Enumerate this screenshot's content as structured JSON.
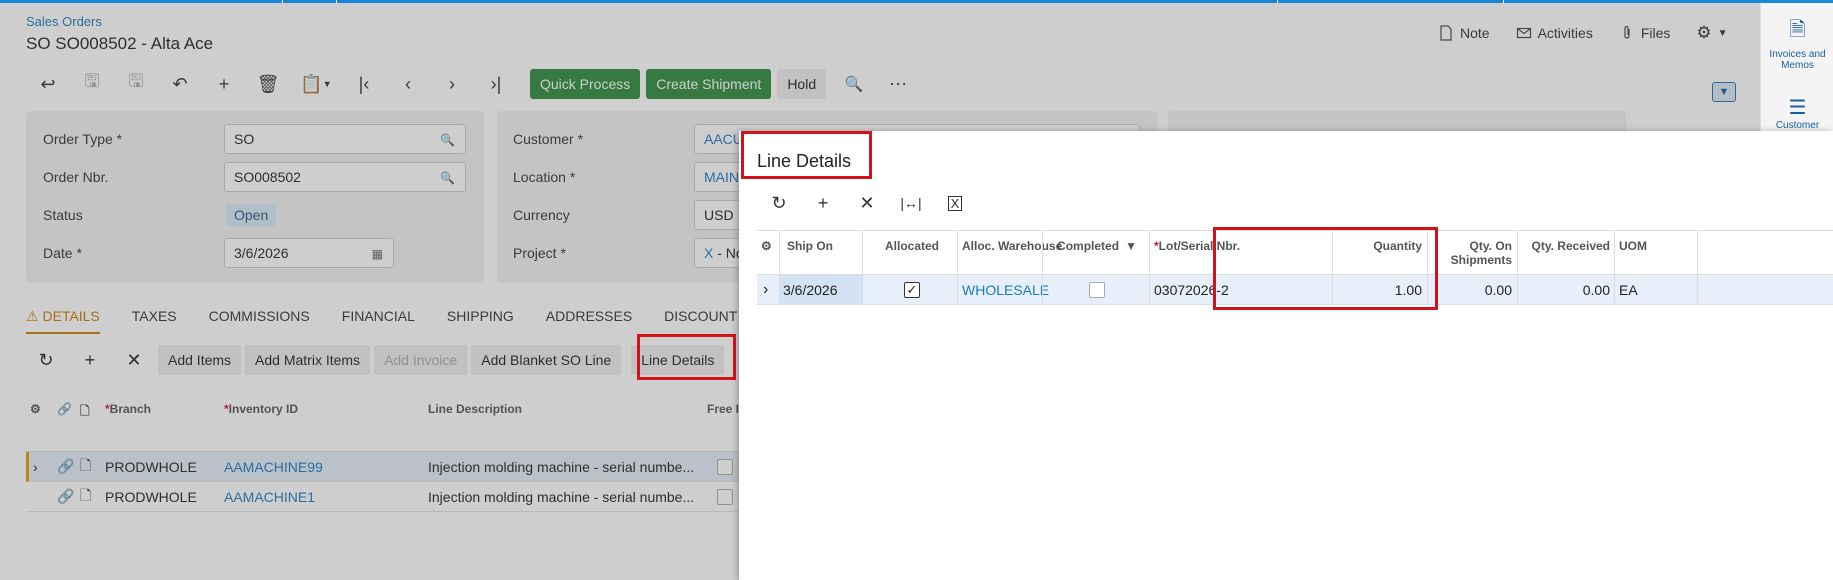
{
  "breadcrumb": "Sales Orders",
  "title": "SO SO008502 - Alta Ace",
  "header_actions": [
    {
      "label": "Note",
      "icon": "note-icon"
    },
    {
      "label": "Activities",
      "icon": "mail-icon"
    },
    {
      "label": "Files",
      "icon": "paperclip-icon"
    }
  ],
  "toolbar": {
    "quick_process": "Quick Process",
    "create_shipment": "Create Shipment",
    "hold": "Hold"
  },
  "form": {
    "order_type_label": "Order Type *",
    "order_type_value": "SO",
    "order_nbr_label": "Order Nbr.",
    "order_nbr_value": "SO008502",
    "status_label": "Status",
    "status_value": "Open",
    "date_label": "Date *",
    "date_value": "3/6/2026",
    "customer_label": "Customer *",
    "customer_value": "AACU",
    "location_label": "Location *",
    "location_value": "MAIN",
    "currency_label": "Currency",
    "currency_value": "USD",
    "project_label": "Project *",
    "project_value": "X",
    "project_suffix": "- No"
  },
  "tabs": [
    "DETAILS",
    "TAXES",
    "COMMISSIONS",
    "FINANCIAL",
    "SHIPPING",
    "ADDRESSES",
    "DISCOUNT"
  ],
  "grid_toolbar": {
    "add_items": "Add Items",
    "add_matrix_items": "Add Matrix Items",
    "add_invoice": "Add Invoice",
    "add_blanket": "Add Blanket SO Line",
    "line_details": "Line Details"
  },
  "lines_grid": {
    "headers": {
      "branch": "Branch",
      "inventory_id": "Inventory ID",
      "line_description": "Line Description",
      "free": "Free I"
    },
    "rows": [
      {
        "branch": "PRODWHOLE",
        "inventory_id": "AAMACHINE99",
        "description": "Injection molding machine - serial numbe..."
      },
      {
        "branch": "PRODWHOLE",
        "inventory_id": "AAMACHINE1",
        "description": "Injection molding machine - serial numbe..."
      }
    ]
  },
  "sidebar": [
    {
      "label": "Invoices and Memos",
      "icon": "invoice-icon"
    },
    {
      "label": "Customer",
      "icon": "customer-icon"
    }
  ],
  "panel": {
    "title": "Line Details",
    "headers": {
      "ship_on": "Ship On",
      "allocated": "Allocated",
      "alloc_warehouse": "Alloc. Warehouse",
      "completed": "Completed",
      "lot_serial": "Lot/Serial Nbr.",
      "quantity": "Quantity",
      "qty_on_shipments": "Qty. On Shipments",
      "qty_received": "Qty. Received",
      "uom": "UOM"
    },
    "row": {
      "ship_on": "3/6/2026",
      "allocated": true,
      "alloc_warehouse": "WHOLESALE",
      "completed": false,
      "lot_serial": "03072026-2",
      "quantity": "1.00",
      "qty_on_shipments": "0.00",
      "qty_received": "0.00",
      "uom": "EA"
    }
  },
  "colors": {
    "accent": "#1a7bbf",
    "green": "#2e8b3c",
    "highlight": "#d0121b",
    "warning": "#c97d00"
  }
}
